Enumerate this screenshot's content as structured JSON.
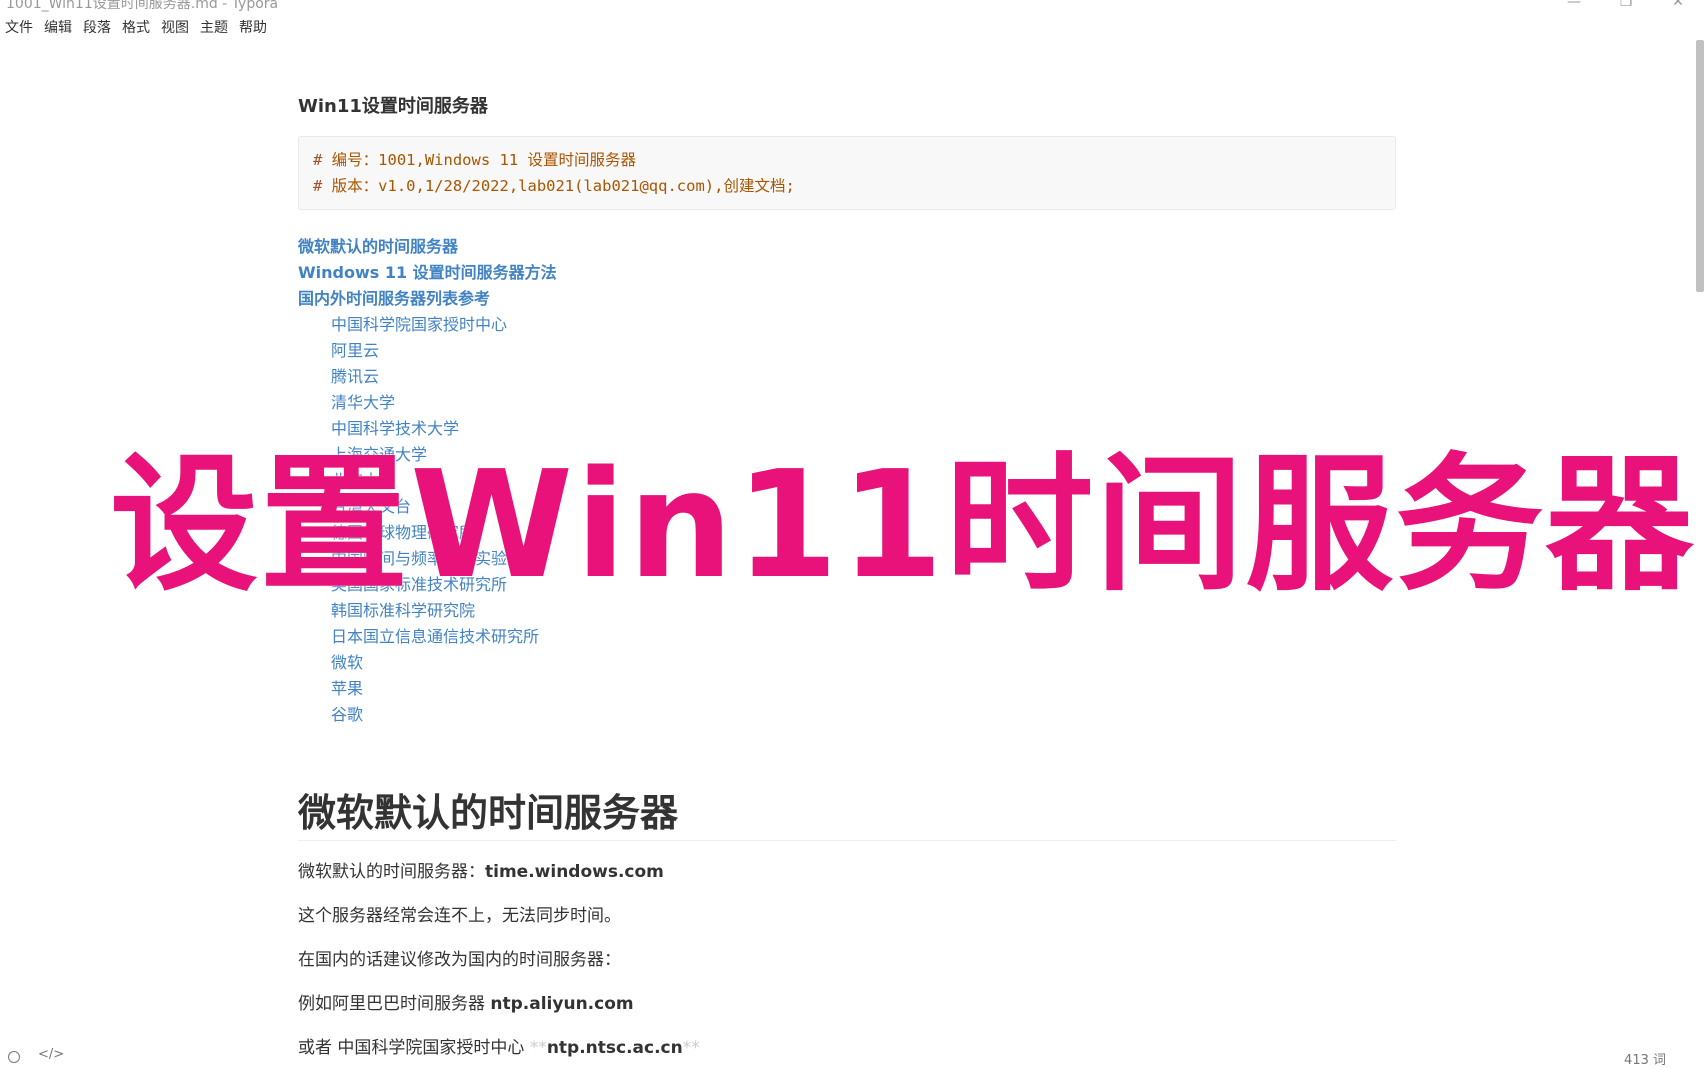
{
  "window": {
    "title": "1001_Win11设置时间服务器.md - Typora",
    "controls": [
      "—",
      "❐",
      "✕"
    ]
  },
  "menubar": {
    "items": [
      "文件",
      "编辑",
      "段落",
      "格式",
      "视图",
      "主题",
      "帮助"
    ]
  },
  "document": {
    "title": "Win11设置时间服务器",
    "code_lines": [
      {
        "hash": "#",
        "text": " 编号：1001,Windows 11 设置时间服务器"
      },
      {
        "hash": "#",
        "text": " 版本：v1.0,1/28/2022,lab021(lab021@qq.com),创建文档;"
      }
    ],
    "toc_h1": [
      "微软默认的时间服务器",
      "Windows 11 设置时间服务器方法",
      "国内外时间服务器列表参考"
    ],
    "toc_h2": [
      "中国科学院国家授时中心",
      "阿里云",
      "腾讯云",
      "清华大学",
      "中国科学技术大学",
      "上海交通大学",
      "北京大学",
      "台湾天文台",
      "德国地球物理研究所",
      "中国时间与频率标准实验室",
      "美国国家标准技术研究所",
      "韩国标准科学研究院",
      "日本国立信息通信技术研究所",
      "微软",
      "苹果",
      "谷歌"
    ],
    "section_heading": "微软默认的时间服务器",
    "p1_label": "微软默认的时间服务器：",
    "p1_value": "time.windows.com",
    "p2": "这个服务器经常会连不上，无法同步时间。",
    "p3": "在国内的话建议修改为国内的时间服务器：",
    "p4_label": "例如阿里巴巴时间服务器 ",
    "p4_value": "ntp.aliyun.com",
    "p5_label": "或者 中国科学院国家授时中心 ",
    "p5_marker_open": "**",
    "p5_value": "ntp.ntsc.ac.cn",
    "p5_marker_close": "**"
  },
  "overlay": {
    "text": "设置Win11时间服务器",
    "color": "#e8127a"
  },
  "statusbar": {
    "source_icon": "</>",
    "word_count": "413 词"
  }
}
